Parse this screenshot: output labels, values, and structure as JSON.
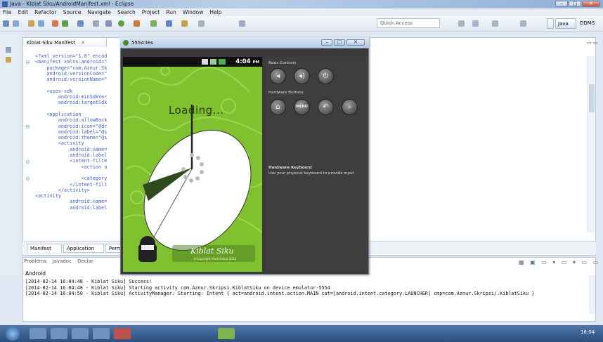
{
  "window": {
    "title": "Java - Kiblat Siku/AndroidManifest.xml - Eclipse",
    "min": "–",
    "max": "□",
    "close": "✕"
  },
  "menu": [
    "File",
    "Edit",
    "Refactor",
    "Source",
    "Navigate",
    "Search",
    "Project",
    "Run",
    "Window",
    "Help"
  ],
  "toolbar": {
    "quick_access_placeholder": "Quick Access",
    "perspectives": [
      "Java",
      "DDMS"
    ]
  },
  "editor": {
    "tab_label": "Kiblat Siku Manifest",
    "tab_close": "✕",
    "code_lines": [
      "<?xml version=\"1.0\" encod",
      "<manifest xmlns:android=\"",
      "    package=\"com.Aznur.Sk",
      "    android:versionCode=\"",
      "    android:versionName=\"",
      "",
      "    <uses-sdk",
      "        android:minSdkVer",
      "        android:targetSdk",
      "",
      "    <application",
      "        android:allowBack",
      "        android:icon=\"@dr",
      "        android:label=\"@s",
      "        android:theme=\"@s",
      "        <activity",
      "            android:name=",
      "            android:label",
      "            <intent-filte",
      "                <action a",
      "",
      "                <category",
      "            </intent-filt",
      "        </activity>",
      "<activity",
      "            android:name=",
      "            android:label"
    ],
    "bottom_tabs": [
      "Manifest",
      "Application",
      "Perm"
    ]
  },
  "console": {
    "tabs": [
      "Problems",
      "Javadoc",
      "Declar"
    ],
    "label": "Android",
    "lines": [
      "[2014-02-14 16:04:48 - Kiblat Siku] Success!",
      "[2014-02-14 16:04:48 - Kiblat Siku] Starting activity com.Aznur.Skripsi.KiblatSiku on device emulator-5554",
      "[2014-02-14 16:04:50 - Kiblat Siku] ActivityManager: Starting: Intent { act=android.intent.action.MAIN cat=[android.intent.category.LAUNCHER] cmp=com.Aznur.Skripsi/.KiblatSiku }"
    ]
  },
  "emulator": {
    "title": "5554:tes",
    "status_time": "4:04",
    "status_ampm": "PM",
    "loading": "Loading...",
    "app_name": "Kiblat Siku",
    "copyright": "©Copyright Pindi Rahul 2013",
    "basic_controls": "Basic Controls",
    "hardware_buttons": "Hardware Buttons",
    "menu_btn": "MENU",
    "keyboard_title": "Hardware Keyboard",
    "keyboard_text": "Use your physical keyboard to provide input"
  },
  "taskbar": {
    "time": "16:04"
  },
  "colors": {
    "screen_green": "#7fc12f",
    "panel": "#3e3e3e"
  }
}
